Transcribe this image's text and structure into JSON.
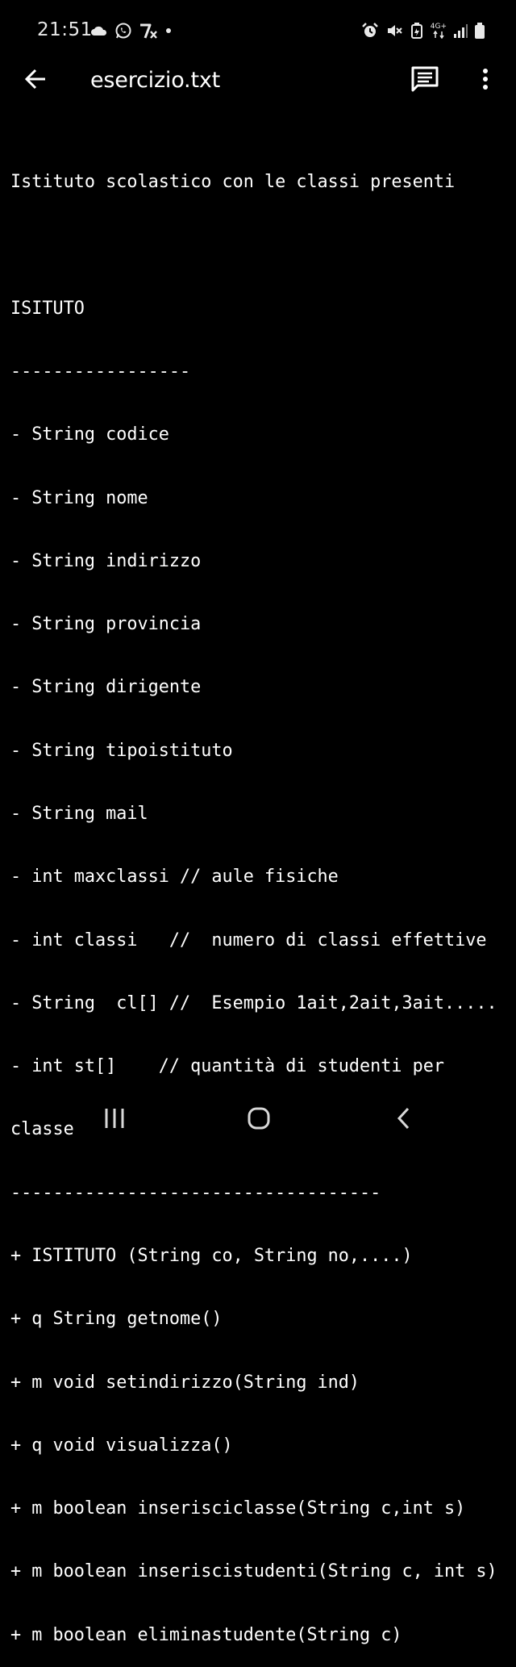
{
  "status_bar": {
    "time": "21:51",
    "network_label": "4G+",
    "icons_left": [
      "cloud-icon",
      "whatsapp-icon",
      "app-notification-icon",
      "dot-icon"
    ],
    "icons_right": [
      "alarm-icon",
      "mute-icon",
      "battery-saver-icon",
      "network-4g-icon",
      "signal-icon",
      "battery-icon"
    ]
  },
  "app_bar": {
    "title": "esercizio.txt",
    "back_icon": "arrow-back-icon",
    "comment_icon": "comment-icon",
    "more_icon": "more-vert-icon"
  },
  "document": {
    "lines": [
      "Istituto scolastico con le classi presenti",
      "",
      "ISITUTO",
      "-----------------",
      "- String codice",
      "- String nome",
      "- String indirizzo",
      "- String provincia",
      "- String dirigente",
      "- String tipoistituto",
      "- String mail",
      "- int maxclassi // aule fisiche",
      "- int classi   //  numero di classi effettive",
      "- String  cl[] //  Esempio 1ait,2ait,3ait.....",
      "- int st[]    // quantità di studenti per",
      "classe",
      "-----------------------------------",
      "+ ISTITUTO (String co, String no,....)",
      "+ q String getnome()",
      "+ m void setindirizzo(String ind)",
      "+ q void visualizza()",
      "+ m boolean inserisciclasse(String c,int s)",
      "+ m boolean inseriscistudenti(String c, int s)",
      "+ m boolean eliminastudente(String c)"
    ]
  },
  "nav_bar": {
    "buttons": [
      "recent-apps-icon",
      "home-icon",
      "back-icon"
    ]
  }
}
